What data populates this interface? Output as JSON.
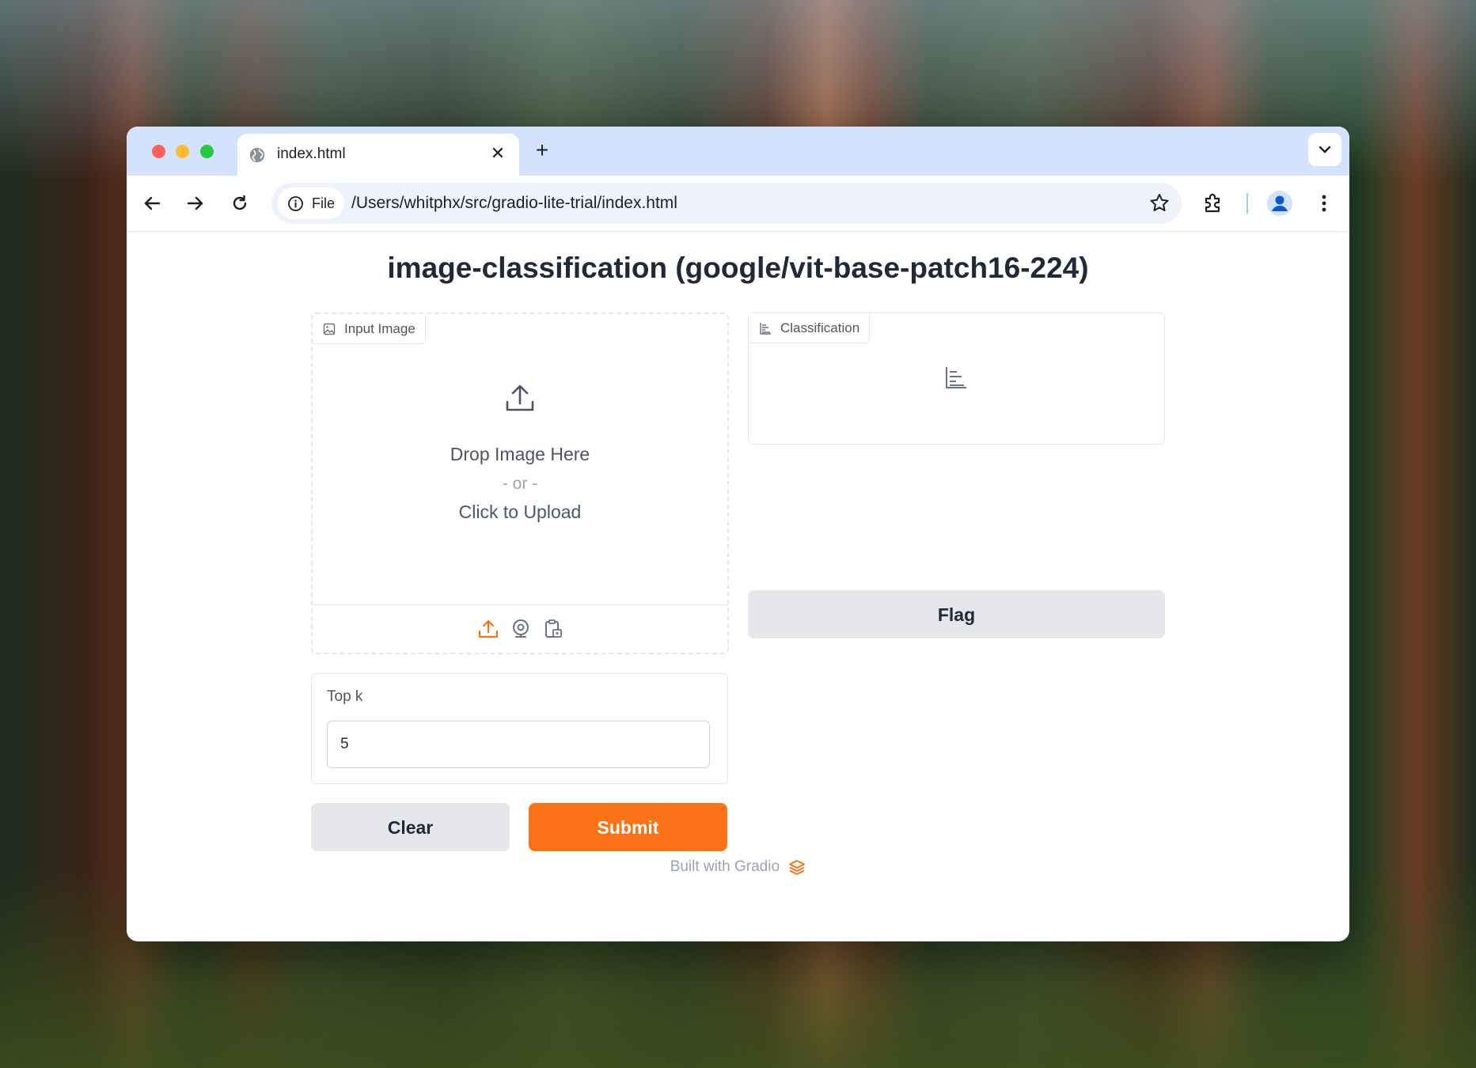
{
  "browser": {
    "tab": {
      "title": "index.html"
    },
    "omnibox": {
      "security_label": "File",
      "url": "/Users/whitphx/src/gradio-lite-trial/index.html"
    }
  },
  "app": {
    "title": "image-classification (google/vit-base-patch16-224)",
    "input_image": {
      "label": "Input Image",
      "drop_text": "Drop Image Here",
      "or_text": "- or -",
      "click_text": "Click to Upload",
      "sources": [
        "upload-icon",
        "webcam-icon",
        "clipboard-icon"
      ]
    },
    "top_k": {
      "label": "Top k",
      "value": "5"
    },
    "buttons": {
      "clear": "Clear",
      "submit": "Submit",
      "flag": "Flag"
    },
    "classification": {
      "label": "Classification"
    },
    "footer": "Built with Gradio"
  },
  "colors": {
    "accent": "#f97316",
    "tabbar": "#d3e3fd",
    "secondary_button": "#e5e7eb"
  }
}
